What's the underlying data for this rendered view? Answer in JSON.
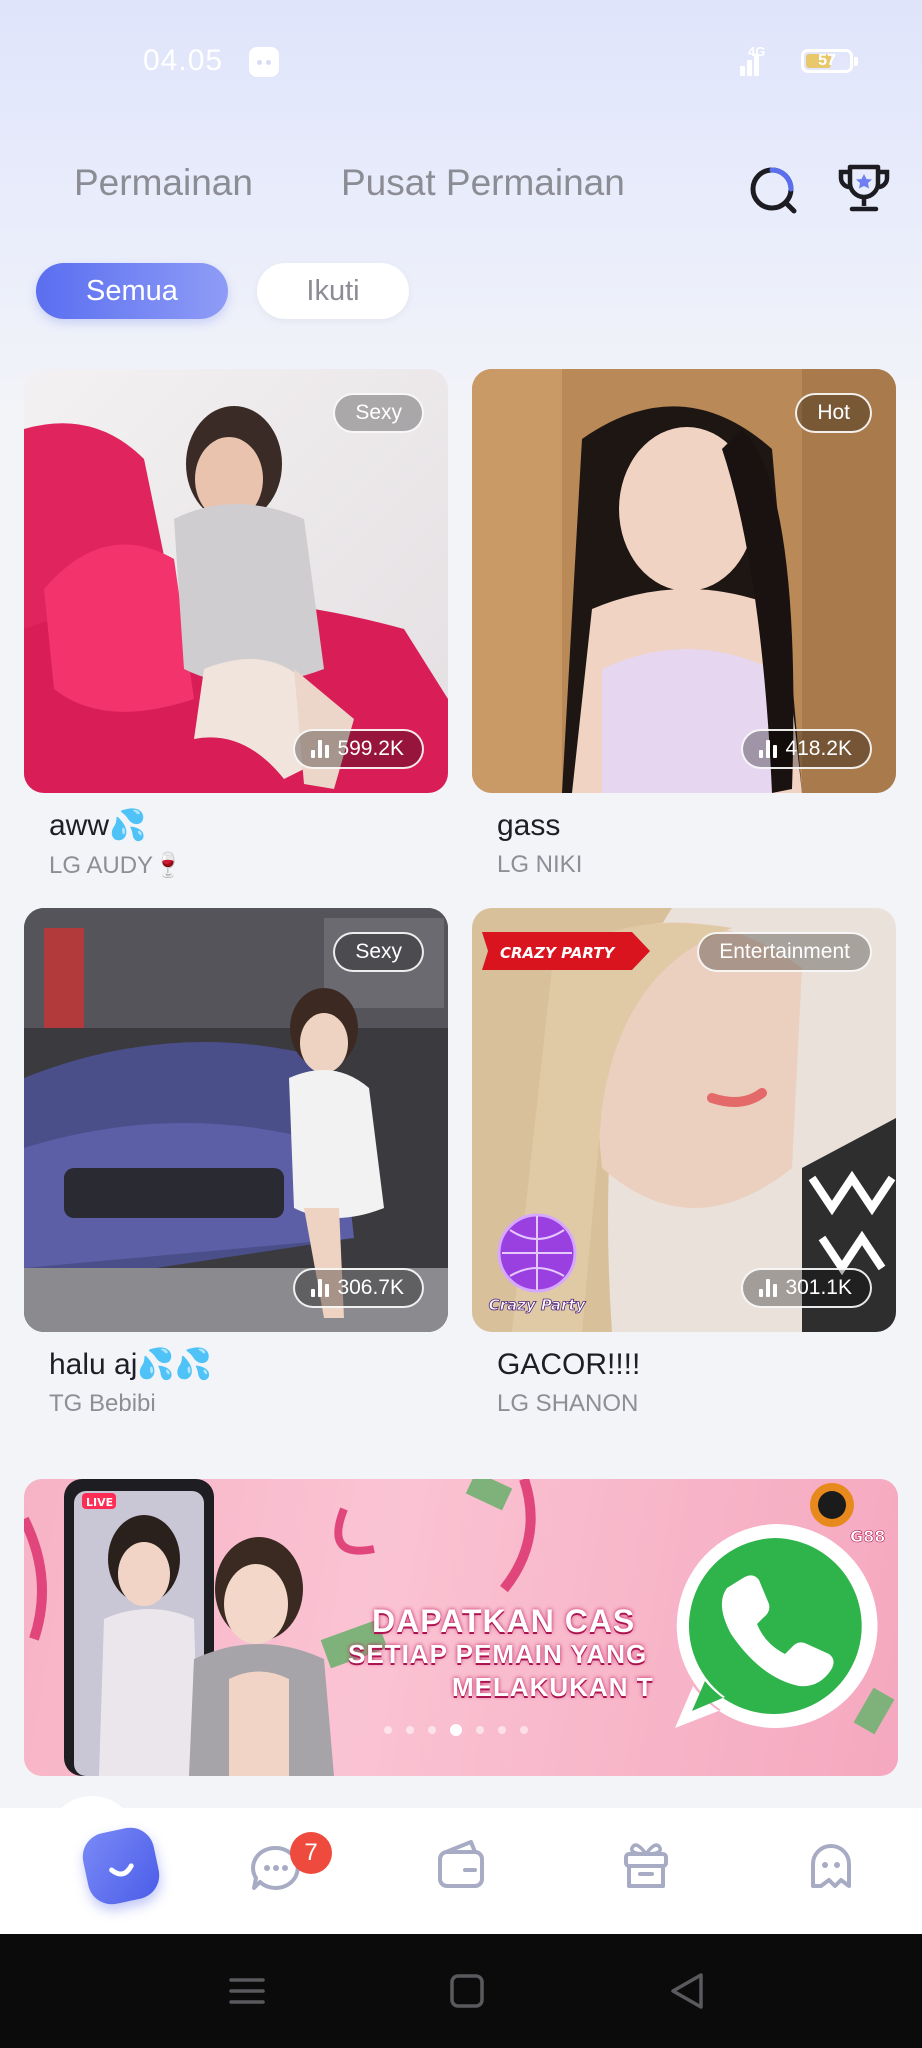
{
  "status_bar": {
    "time": "04.05",
    "network": "4G",
    "battery_level": "57"
  },
  "header": {
    "tabs": [
      {
        "label": "Permainan"
      },
      {
        "label": "Pusat Permainan"
      }
    ],
    "icons": [
      "search-icon",
      "trophy-icon"
    ]
  },
  "filters": {
    "active": "Semua",
    "inactive": "Ikuti"
  },
  "streams": [
    {
      "tag": "Sexy",
      "viewers": "599.2K",
      "title": "aww",
      "title_emoji": "💦",
      "host": "LG AUDY",
      "host_emoji": "🍷"
    },
    {
      "tag": "Hot",
      "viewers": "418.2K",
      "title": "gass",
      "title_emoji": "",
      "host": "LG NIKI",
      "host_emoji": ""
    },
    {
      "tag": "Sexy",
      "viewers": "306.7K",
      "title": "halu aj",
      "title_emoji": "💦💦",
      "host": "TG Bebibi",
      "host_emoji": ""
    },
    {
      "tag": "Entertainment",
      "viewers": "301.1K",
      "title": "GACOR!!!!",
      "title_emoji": "",
      "host": "LG SHANON",
      "host_emoji": "",
      "banner_label": "CRAZY PARTY",
      "badge_label": "Crazy Party"
    }
  ],
  "promo": {
    "line1": "DAPATKAN CAS",
    "line2": "SETIAP PEMAIN YANG",
    "line3": "MELAKUKAN T",
    "live_label": "LIVE",
    "brand_label": "G88",
    "colors": {
      "bg": "#f7b3c6",
      "text_stroke": "#c2185b"
    }
  },
  "bottom_nav": {
    "items": [
      "home-icon",
      "chat-icon",
      "wallet-icon",
      "gift-icon",
      "profile-icon"
    ],
    "chat_badge": "7",
    "accent": "#5a6ef0"
  },
  "system_nav": [
    "menu-icon",
    "home-square-icon",
    "back-icon"
  ]
}
